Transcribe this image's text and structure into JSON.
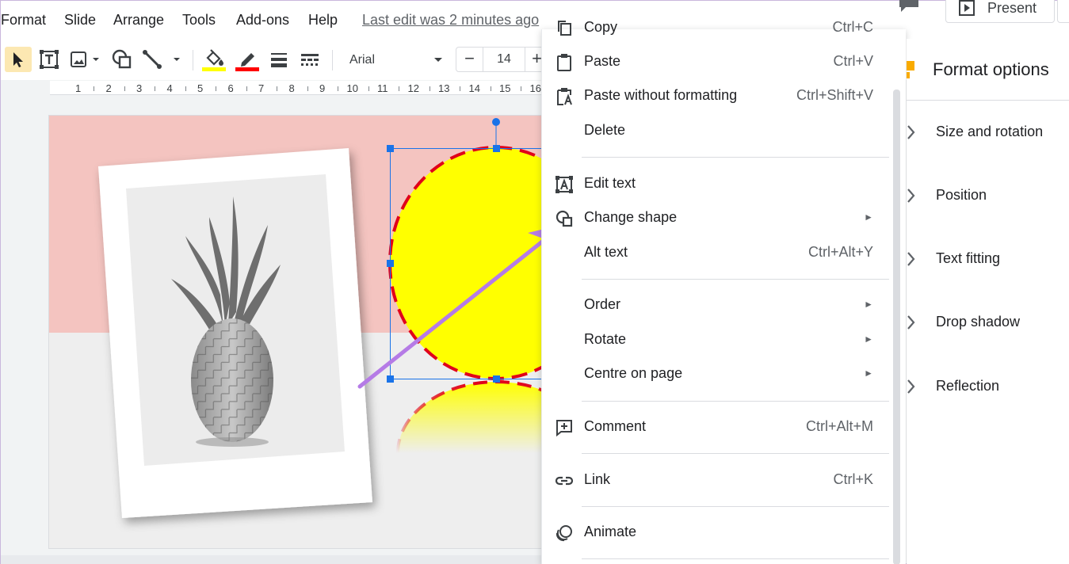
{
  "menubar": {
    "items": [
      "Format",
      "Slide",
      "Arrange",
      "Tools",
      "Add-ons",
      "Help"
    ],
    "last_edit": "Last edit was 2 minutes ago",
    "present_label": "Present"
  },
  "toolbar": {
    "font_name": "Arial",
    "font_size": "14",
    "minus": "−",
    "plus": "+",
    "fill_color": "#ffff00",
    "border_color": "#ff0000"
  },
  "ruler": {
    "numbers": [
      "1",
      "2",
      "3",
      "4",
      "5",
      "6",
      "7",
      "8",
      "9",
      "10",
      "11",
      "12",
      "13",
      "14",
      "15",
      "16"
    ]
  },
  "context_menu": {
    "copy": {
      "label": "Copy",
      "shortcut": "Ctrl+C"
    },
    "paste": {
      "label": "Paste",
      "shortcut": "Ctrl+V"
    },
    "paste_plain": {
      "label": "Paste without formatting",
      "shortcut": "Ctrl+Shift+V"
    },
    "delete": {
      "label": "Delete"
    },
    "edit_text": {
      "label": "Edit text"
    },
    "change_shape": {
      "label": "Change shape",
      "arrow": "►"
    },
    "alt_text": {
      "label": "Alt text",
      "shortcut": "Ctrl+Alt+Y"
    },
    "order": {
      "label": "Order",
      "arrow": "►"
    },
    "rotate": {
      "label": "Rotate",
      "arrow": "►"
    },
    "centre": {
      "label": "Centre on page",
      "arrow": "►"
    },
    "comment": {
      "label": "Comment",
      "shortcut": "Ctrl+Alt+M"
    },
    "link": {
      "label": "Link",
      "shortcut": "Ctrl+K"
    },
    "animate": {
      "label": "Animate"
    }
  },
  "format_panel": {
    "title": "Format options",
    "sections": [
      "Size and rotation",
      "Position",
      "Text fitting",
      "Drop shadow",
      "Reflection"
    ]
  },
  "colors": {
    "slide_top": "#f4c4c0",
    "shape_fill": "#ffff00",
    "shape_border": "#e0001a",
    "selection": "#1a73e8",
    "annotation_arrow": "#b57be6"
  }
}
